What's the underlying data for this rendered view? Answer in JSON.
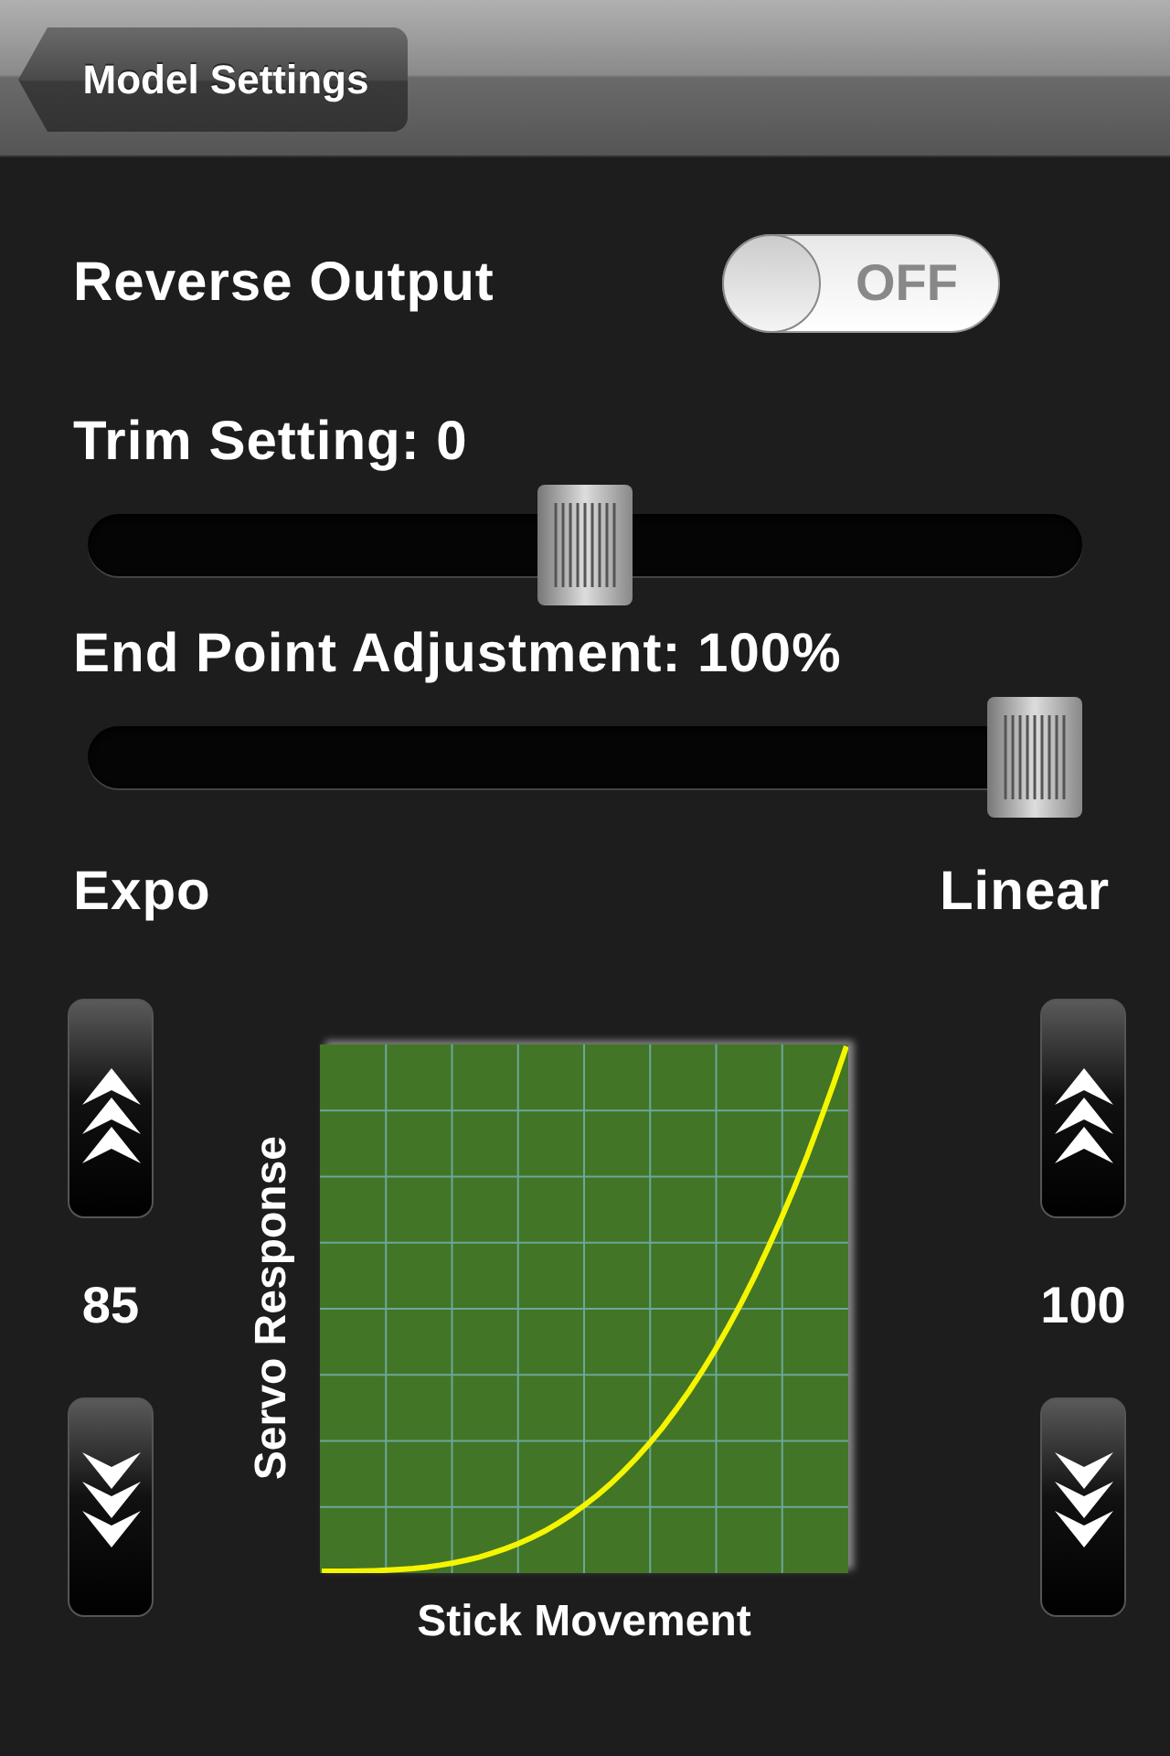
{
  "nav": {
    "back_button": "Model Settings"
  },
  "reverse_output": {
    "label": "Reverse Output",
    "on": false,
    "switch_text": "OFF"
  },
  "sliders": [
    {
      "label": "Trim Setting: 0",
      "level": 0.5
    },
    {
      "label": "End Point Adjustment: 100%",
      "level": 1
    }
  ],
  "curve": {
    "left_label": "Expo",
    "right_label": "Linear",
    "left_value": "85",
    "right_value": "100",
    "ylabel": "Servo Response",
    "xlabel": "Stick Movement"
  }
}
